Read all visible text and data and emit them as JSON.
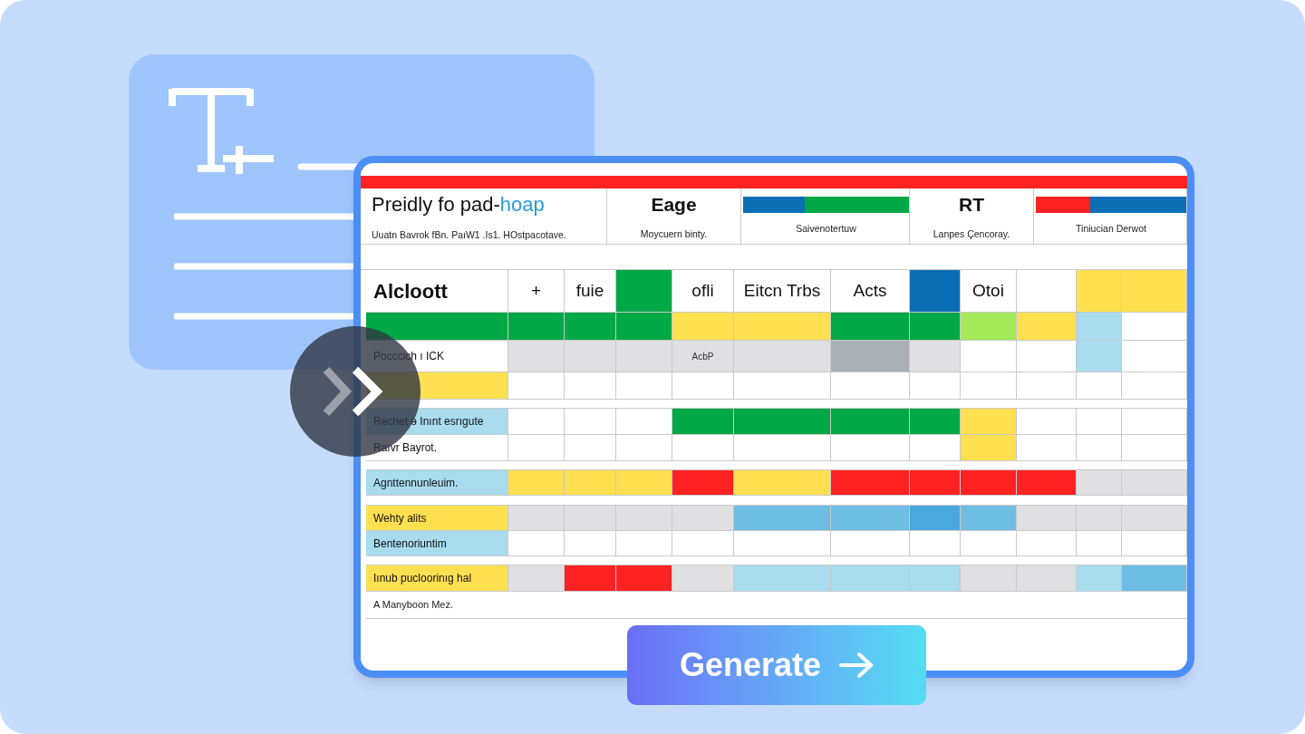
{
  "sheet": {
    "header_cells": [
      {
        "kind": "text",
        "title": "Preidly fo pad-",
        "title_accent": "hoap",
        "subtitle": "Uuatn Bavrok fBn. PaıW1 .Is1. HOstpacotave."
      },
      {
        "kind": "text",
        "title": "Eage",
        "subtitle": "Moycuern binty."
      },
      {
        "kind": "bar",
        "segments": [
          {
            "color": "#0a6fb5"
          },
          {
            "color": "#00a846"
          }
        ],
        "level": 0.37,
        "subtitle": "Saivenotertuw"
      },
      {
        "kind": "text",
        "title": "RT",
        "subtitle": "Lanpes Çencoray."
      },
      {
        "kind": "bar",
        "segments": [
          {
            "color": "#ff2222"
          },
          {
            "color": "#0a6fb5"
          }
        ],
        "level": 0.36,
        "subtitle": "Tiniucian Derwot"
      }
    ],
    "column_heads": {
      "label": "Alcloott",
      "cells": [
        {
          "text": "+"
        },
        {
          "text": "fuie"
        },
        {
          "color": "#00a846"
        },
        {
          "text": "ofli"
        },
        {
          "text": "Eitcn Trbs"
        },
        {
          "text": "Acts"
        },
        {
          "color": "#0a6fb5"
        },
        {
          "text": "Otoi"
        },
        {},
        {
          "color": "#ffe050"
        },
        {
          "color": "#ffe050"
        }
      ]
    },
    "rows": [
      {
        "kind": "row",
        "color": "#00a846",
        "cells": [
          {
            "color": "#00a846"
          },
          {
            "color": "#00a846"
          },
          {
            "color": "#00a846"
          },
          {
            "color": "#ffe050"
          },
          {
            "color": "#ffe050"
          },
          {
            "color": "#00a846"
          },
          {
            "color": "#00a846"
          },
          {
            "color": "#a3e958"
          },
          {
            "color": "#ffe050"
          },
          {
            "color": "#a8dcee"
          },
          {}
        ]
      },
      {
        "kind": "row",
        "label": "Pocccich ı ICK",
        "cells": [
          {
            "color": "#e0e0e2"
          },
          {
            "color": "#e0e0e2"
          },
          {
            "color": "#e0e0e2"
          },
          {
            "color": "#e0e0e2",
            "text": "AcbP"
          },
          {
            "color": "#e0e0e2"
          },
          {
            "color": "#a9b0b4"
          },
          {
            "color": "#e0e0e2"
          },
          {},
          {},
          {
            "color": "#a8dcee"
          },
          {}
        ]
      },
      {
        "kind": "row",
        "color": "#ffe050",
        "cells": [
          {},
          {},
          {},
          {},
          {},
          {},
          {},
          {},
          {},
          {},
          {}
        ]
      },
      {
        "kind": "gap"
      },
      {
        "kind": "row",
        "label": "Rechet ə Inınt esrıgute",
        "color": "#a8dcee",
        "cells": [
          {},
          {},
          {},
          {
            "color": "#00a846"
          },
          {
            "color": "#00a846"
          },
          {
            "color": "#00a846"
          },
          {
            "color": "#00a846"
          },
          {
            "color": "#ffe050"
          },
          {},
          {},
          {}
        ]
      },
      {
        "kind": "row",
        "label": "Raıvr Bayrot.",
        "cells": [
          {},
          {},
          {},
          {},
          {},
          {},
          {},
          {
            "color": "#ffe050"
          },
          {},
          {},
          {}
        ]
      },
      {
        "kind": "gap"
      },
      {
        "kind": "row",
        "label": "Agnttennunleuim.",
        "color": "#a8dcee",
        "cells": [
          {
            "color": "#ffe050"
          },
          {
            "color": "#ffe050"
          },
          {
            "color": "#ffe050"
          },
          {
            "color": "#ff2222"
          },
          {
            "color": "#ffe050"
          },
          {
            "color": "#ff2222"
          },
          {
            "color": "#ff2222"
          },
          {
            "color": "#ff2222"
          },
          {
            "color": "#ff2222"
          },
          {
            "color": "#e0e0e2"
          },
          {
            "color": "#e0e0e2"
          }
        ]
      },
      {
        "kind": "gap"
      },
      {
        "kind": "row",
        "label": "Wehty alits",
        "color": "#ffe050",
        "cells": [
          {
            "color": "#e0e0e2"
          },
          {
            "color": "#e0e0e2"
          },
          {
            "color": "#e0e0e2"
          },
          {
            "color": "#e0e0e2"
          },
          {
            "color": "#6ebde3"
          },
          {
            "color": "#6ebde3"
          },
          {
            "color": "#4aa8dc"
          },
          {
            "color": "#6ebde3"
          },
          {
            "color": "#e0e0e2"
          },
          {
            "color": "#e0e0e2"
          },
          {
            "color": "#e0e0e2"
          }
        ]
      },
      {
        "kind": "row",
        "label": "Bentenoriuntim",
        "color": "#a8dcee",
        "cells": [
          {},
          {},
          {},
          {},
          {},
          {},
          {},
          {},
          {},
          {},
          {}
        ]
      },
      {
        "kind": "gap"
      },
      {
        "kind": "row",
        "label": "Iınub pucloorinıg hal",
        "color": "#ffe050",
        "cells": [
          {
            "color": "#e0e0e2"
          },
          {
            "color": "#ff2222"
          },
          {
            "color": "#ff2222"
          },
          {
            "color": "#e0e0e2"
          },
          {
            "color": "#a8dcee"
          },
          {
            "color": "#a8dcee"
          },
          {
            "color": "#a8dcee"
          },
          {
            "color": "#e0e0e2"
          },
          {
            "color": "#e0e0e2"
          },
          {
            "color": "#a8dcee"
          },
          {
            "color": "#6ebde3"
          }
        ]
      }
    ],
    "footer": "A Manyboon Mez."
  },
  "generate_button": {
    "label": "Generate"
  }
}
